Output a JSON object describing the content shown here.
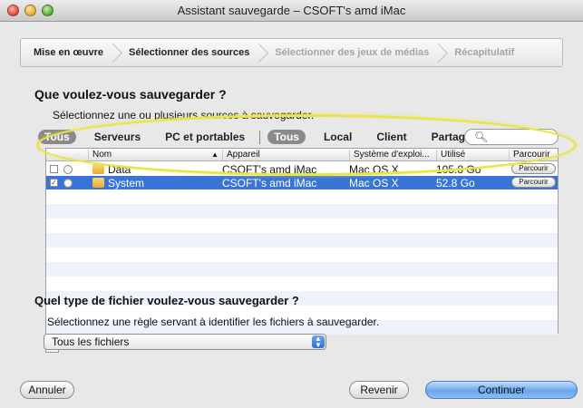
{
  "window": {
    "title": "Assistant sauvegarde – CSOFT's amd iMac"
  },
  "steps": [
    {
      "label": "Mise en œuvre",
      "state": "done"
    },
    {
      "label": "Sélectionner des sources",
      "state": "current"
    },
    {
      "label": "Sélectionner des jeux de médias",
      "state": "pending"
    },
    {
      "label": "Récapitulatif",
      "state": "pending"
    }
  ],
  "sources": {
    "question": "Que voulez-vous sauvegarder ?",
    "instruction": "Sélectionnez une ou plusieurs sources à sauvegarder.",
    "filters_left": [
      "Tous",
      "Serveurs",
      "PC et portables"
    ],
    "filters_right": [
      "Tous",
      "Local",
      "Client",
      "Partages"
    ],
    "search_placeholder": "",
    "columns": [
      "Nom",
      "Appareil",
      "Système d'exploi...",
      "Utilisé",
      "Parcourir"
    ],
    "rows": [
      {
        "checked": false,
        "name": "Data",
        "device": "CSOFT's amd iMac",
        "os": "Mac OS X",
        "used": "105.8 Go",
        "action": "Parcourir",
        "selected": false
      },
      {
        "checked": true,
        "name": "System",
        "device": "CSOFT's amd iMac",
        "os": "Mac OS X",
        "used": "52.8 Go",
        "action": "Parcourir",
        "selected": true
      }
    ],
    "add_label": "+"
  },
  "filetype": {
    "question": "Quel type de fichier voulez-vous sauvegarder ?",
    "instruction": "Sélectionnez une règle servant à identifier les fichiers à sauvegarder.",
    "selected": "Tous les fichiers"
  },
  "footer": {
    "cancel": "Annuler",
    "back": "Revenir",
    "continue": "Continuer"
  },
  "colors": {
    "selection": "#3875d7",
    "highlight": "#e8e44d"
  }
}
